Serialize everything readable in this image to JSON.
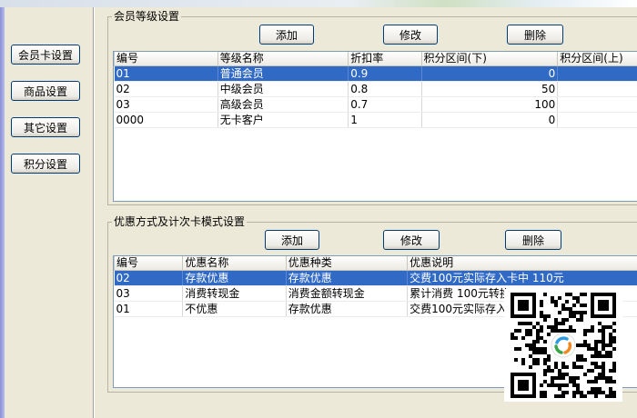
{
  "nav": {
    "items": [
      "会员卡设置",
      "商品设置",
      "其它设置",
      "积分设置"
    ]
  },
  "member_levels": {
    "title": "会员等级设置",
    "buttons": {
      "add": "添加",
      "edit": "修改",
      "delete": "删除"
    },
    "columns": [
      "编号",
      "等级名称",
      "折扣率",
      "积分区间(下)",
      "积分区间(上)"
    ],
    "rows": [
      [
        "01",
        "普通会员",
        "0.9",
        "0",
        ""
      ],
      [
        "02",
        "中级会员",
        "0.8",
        "50",
        ""
      ],
      [
        "03",
        "高级会员",
        "0.7",
        "100",
        ""
      ],
      [
        "0000",
        "无卡客户",
        "1",
        "0",
        ""
      ]
    ],
    "selected_row": 0
  },
  "discounts": {
    "title": "优惠方式及计次卡模式设置",
    "buttons": {
      "add": "添加",
      "edit": "修改",
      "delete": "删除"
    },
    "columns": [
      "编号",
      "优惠名称",
      "优惠种类",
      "优惠说明"
    ],
    "rows": [
      [
        "02",
        "存款优惠",
        "存款优惠",
        "交费100元实际存入卡中 110元"
      ],
      [
        "03",
        "消费转现金",
        "消费金额转现金",
        "累计消费 100元转换"
      ],
      [
        "01",
        "不优惠",
        "存款优惠",
        "交费100元实际存入卡"
      ]
    ],
    "selected_row": 0
  },
  "colors": {
    "selection": "#316ac5",
    "background": "#ece9d8",
    "button_border": "#003c74"
  }
}
